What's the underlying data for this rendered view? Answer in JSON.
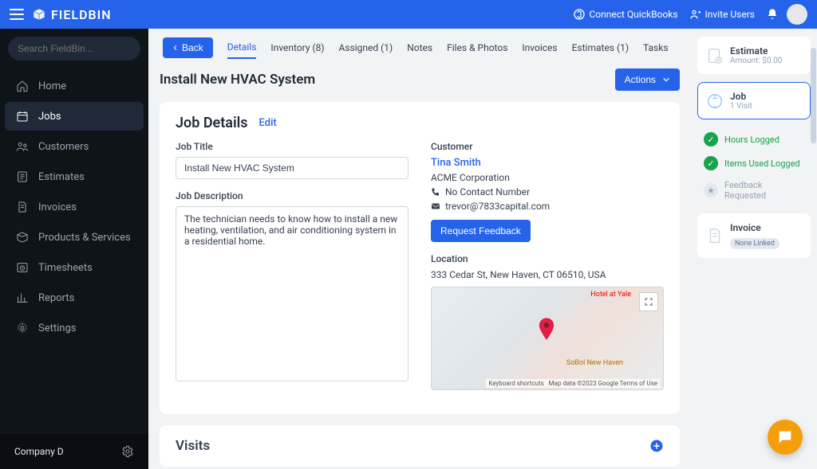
{
  "header": {
    "brand": "FIELDBIN",
    "connect_qb": "Connect QuickBooks",
    "invite_users": "Invite Users"
  },
  "search": {
    "placeholder": "Search FieldBin..."
  },
  "sidebar": {
    "items": [
      {
        "label": "Home"
      },
      {
        "label": "Jobs"
      },
      {
        "label": "Customers"
      },
      {
        "label": "Estimates"
      },
      {
        "label": "Invoices"
      },
      {
        "label": "Products & Services"
      },
      {
        "label": "Timesheets"
      },
      {
        "label": "Reports"
      },
      {
        "label": "Settings"
      }
    ],
    "company": "Company D"
  },
  "toolbar": {
    "back": "Back",
    "tabs": {
      "details": "Details",
      "inventory": "Inventory (8)",
      "assigned": "Assigned (1)",
      "notes": "Notes",
      "files": "Files & Photos",
      "invoices": "Invoices",
      "estimates": "Estimates (1)",
      "tasks": "Tasks"
    }
  },
  "page": {
    "title": "Install New HVAC System",
    "actions": "Actions"
  },
  "job_details": {
    "heading": "Job Details",
    "edit": "Edit",
    "title_label": "Job Title",
    "title_value": "Install New HVAC System",
    "desc_label": "Job Description",
    "desc_value": "The technician needs to know how to install a new heating, ventilation, and air conditioning system in a residential home.",
    "customer_label": "Customer",
    "customer_name": "Tina Smith",
    "customer_company": "ACME Corporation",
    "customer_phone": "No Contact Number",
    "customer_email": "trevor@7833capital.com",
    "feedback_btn": "Request Feedback",
    "location_label": "Location",
    "location_value": "333 Cedar St, New Haven, CT 06510, USA",
    "map_hotel": "Hotel at Yale",
    "map_sobol": "SoBol New Haven",
    "map_attr": "Map data ©2023 Google   Terms of Use",
    "map_kb": "Keyboard shortcuts"
  },
  "visits": {
    "heading": "Visits"
  },
  "right": {
    "estimate": {
      "title": "Estimate",
      "sub": "Amount: $0.00"
    },
    "job": {
      "title": "Job",
      "sub": "1 Visit"
    },
    "hours": "Hours Logged",
    "items": "Items Used Logged",
    "feedback": "Feedback Requested",
    "invoice": {
      "title": "Invoice",
      "badge": "None Linked"
    }
  }
}
